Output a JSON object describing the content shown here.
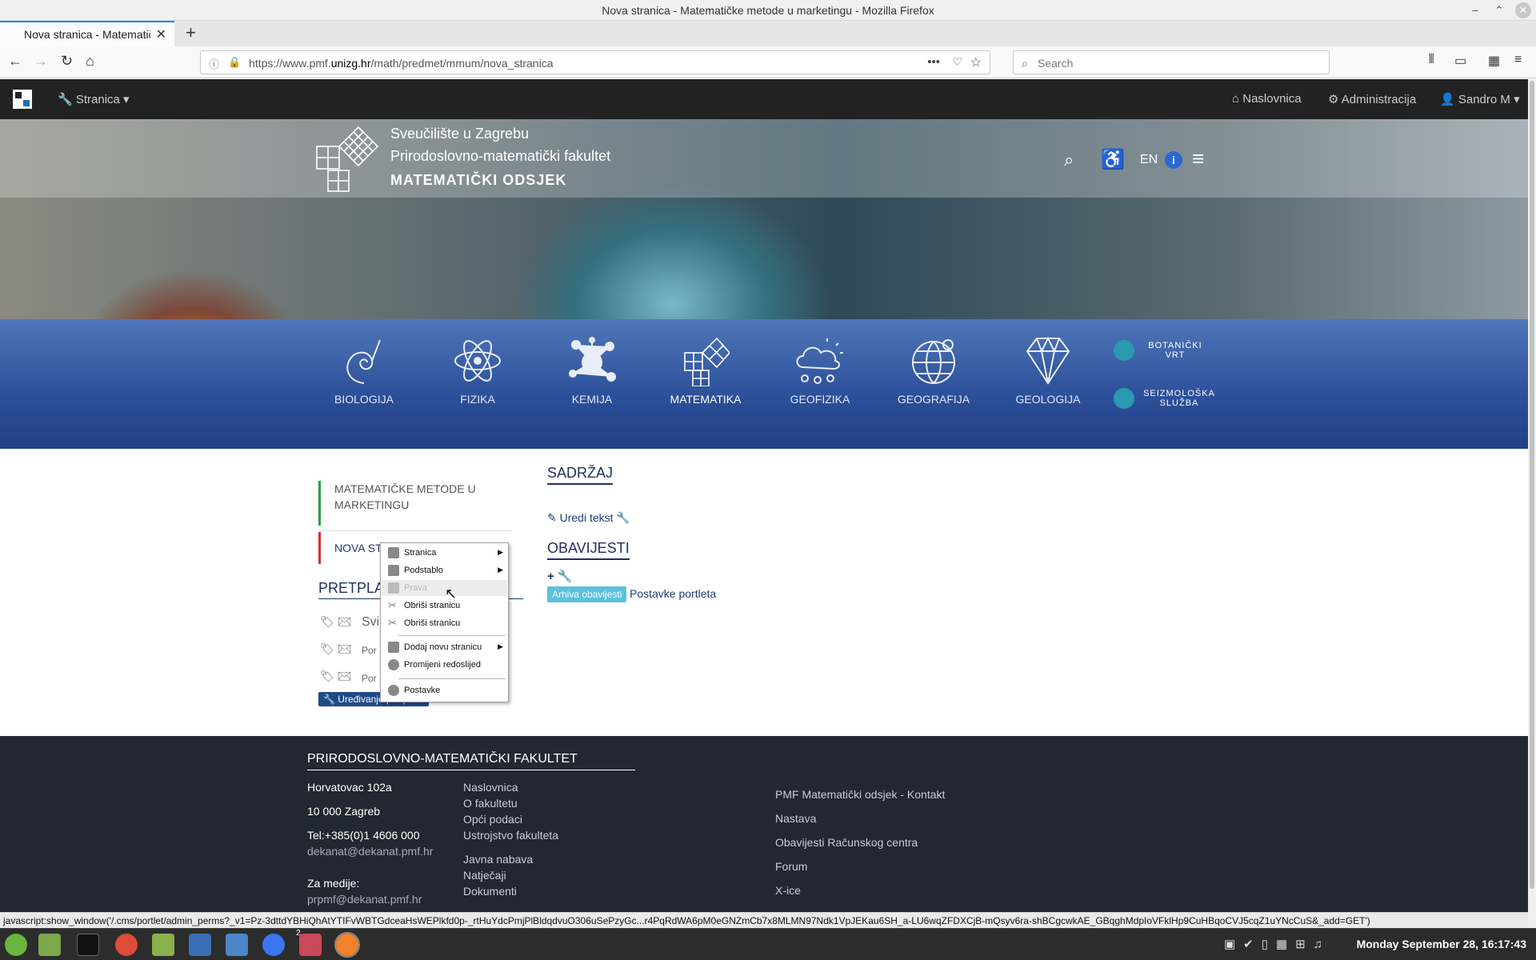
{
  "window": {
    "title": "Nova stranica - Matematičke metode u marketingu - Mozilla Firefox"
  },
  "tab": {
    "title": "Nova stranica - Matematič"
  },
  "url": {
    "prefix": "https://www.pmf.",
    "domain": "unizg.hr",
    "path": "/math/predmet/mmum/nova_stranica"
  },
  "search": {
    "placeholder": "Search"
  },
  "adminbar": {
    "stranica": "Stranica",
    "naslovnica": "Naslovnica",
    "administracija": "Administracija",
    "user": "Sandro M"
  },
  "header": {
    "line1": "Sveučilište u Zagrebu",
    "line2": "Prirodoslovno-matematički fakultet",
    "line3": "MATEMATIČKI ODSJEK",
    "lang": "EN"
  },
  "departments": [
    {
      "label": "BIOLOGIJA",
      "icon": "shell-icon"
    },
    {
      "label": "FIZIKA",
      "icon": "atom-icon"
    },
    {
      "label": "KEMIJA",
      "icon": "molecule-icon"
    },
    {
      "label": "MATEMATIKA",
      "icon": "grid-icon"
    },
    {
      "label": "GEOFIZIKA",
      "icon": "cloud-icon"
    },
    {
      "label": "GEOGRAFIJA",
      "icon": "globe-icon"
    },
    {
      "label": "GEOLOGIJA",
      "icon": "diamond-icon"
    }
  ],
  "side_links": {
    "botanicki_1": "BOTANIČKI",
    "botanicki_2": "VRT",
    "seizmo_1": "SEIZMOLOŠKA",
    "seizmo_2": "SLUŽBA"
  },
  "left_menu": {
    "item1": "MATEMATIČKE METODE U MARKETINGU",
    "item2": "NOVA STR",
    "pretplata": "PRETPLA",
    "svi": "Svi",
    "por1": "Por",
    "por2": "Por",
    "edit_btn": "Uređivanje pretplata"
  },
  "content": {
    "sadrzaj": "SADRŽAJ",
    "uredi": "Uredi tekst",
    "obavijesti": "OBAVIJESTI",
    "arhiva": "Arhiva obavijesti",
    "postavke": "Postavke portleta"
  },
  "context_menu": {
    "items": [
      "Stranica",
      "Podstablo",
      "Prava",
      "Obriši stranicu",
      "Obriši stranicu",
      "Dodaj novu stranicu",
      "Promijeni redoslijed",
      "Postavke"
    ]
  },
  "footer": {
    "title": "PRIRODOSLOVNO-MATEMATIČKI FAKULTET",
    "address1": "Horvatovac 102a",
    "address2": "10 000 Zagreb",
    "tel": "Tel:+385(0)1 4606 000",
    "email": "dekanat@dekanat.pmf.hr",
    "media": "Za medije:",
    "media_email": "prpmf@dekanat.pmf.hr",
    "links1": [
      "Naslovnica",
      "O fakultetu",
      "Opći podaci",
      "Ustrojstvo fakulteta"
    ],
    "links2": [
      "Javna nabava",
      "Natječaji",
      "Dokumenti"
    ],
    "links3": [
      "PMF Matematički odsjek - Kontakt",
      "Nastava",
      "Obavijesti Računskog centra",
      "Forum",
      "X-ice"
    ]
  },
  "statusbar": {
    "text": "javascript:show_window('/.cms/portlet/admin_perms?_v1=Pz-3dttdYBHiQhAtYTIFvWBTGdceaHsWEPlkfd0p-_rtHuYdcPmjPlBldqdvuO306uSePzyGc...r4PqRdWA6pM0eGNZmCb7x8MLMN97Ndk1VpJEKau6SH_a-LU6wqZFDXCjB-mQsyv6ra-shBCgcwkAE_GBqghMdpIoVFklHp9CuHBqoCVJ5cqZ1uYNcCuS&_add=GET')"
  },
  "taskbar": {
    "clock": "Monday September 28, 16:17:43",
    "badge": "2"
  }
}
